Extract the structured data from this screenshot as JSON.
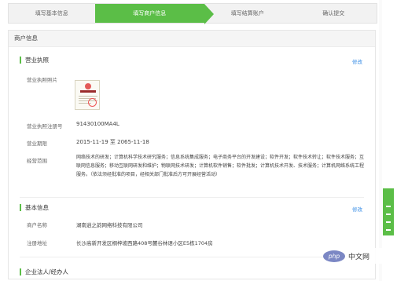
{
  "steps": [
    "填写基本信息",
    "填写商户信息",
    "填写结算账户",
    "确认提交"
  ],
  "panel_title": "商户信息",
  "license_section": {
    "title": "营业执照",
    "edit": "修改",
    "photo_label": "营业执照照片",
    "reg_no_label": "营业执照注册号",
    "reg_no": "91430100MA4L",
    "term_label": "营业期限",
    "term": "2015-11-19 至 2065-11-18",
    "scope_label": "经营范围",
    "scope": "网络技术的研发；计算机科学技术研究服务；信息系统集成服务；电子商务平台的开发建设；软件开发；软件技术转让；软件技术服务；互联网信息服务；移动互联网研发和维护；物联网技术研发；计算机软件销售；软件批发；计算机技术开发、技术服务；计算机网络系统工程服务。（依法须经批准的项目，经相关部门批准后方可开展经营活动）"
  },
  "basic_section": {
    "title": "基本信息",
    "edit": "修改",
    "name_label": "商户名称",
    "name": "湖南逍之韵网络科技有限公司",
    "address_label": "注册地址",
    "address": "长沙高新开发区桐梓坡西路408号麓谷林语小区E5栋1704房"
  },
  "legal_section": {
    "title": "企业法人/经办人"
  },
  "watermark": {
    "logo": "php",
    "text": "中文网"
  },
  "colors": {
    "accent": "#5bbe47",
    "link": "#3a8ee6"
  }
}
